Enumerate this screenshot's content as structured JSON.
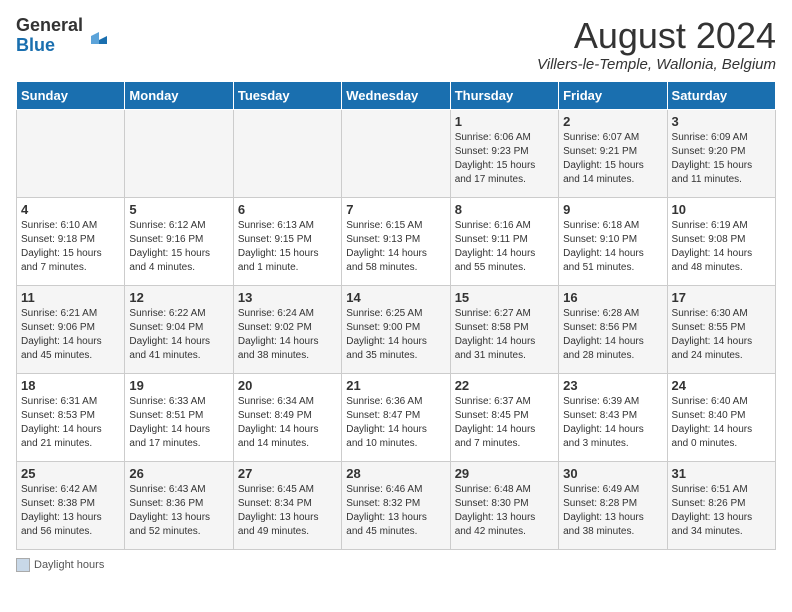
{
  "logo": {
    "general": "General",
    "blue": "Blue"
  },
  "header": {
    "month": "August 2024",
    "location": "Villers-le-Temple, Wallonia, Belgium"
  },
  "weekdays": [
    "Sunday",
    "Monday",
    "Tuesday",
    "Wednesday",
    "Thursday",
    "Friday",
    "Saturday"
  ],
  "legend": {
    "label": "Daylight hours"
  },
  "weeks": [
    [
      {
        "day": "",
        "info": ""
      },
      {
        "day": "",
        "info": ""
      },
      {
        "day": "",
        "info": ""
      },
      {
        "day": "",
        "info": ""
      },
      {
        "day": "1",
        "info": "Sunrise: 6:06 AM\nSunset: 9:23 PM\nDaylight: 15 hours and 17 minutes."
      },
      {
        "day": "2",
        "info": "Sunrise: 6:07 AM\nSunset: 9:21 PM\nDaylight: 15 hours and 14 minutes."
      },
      {
        "day": "3",
        "info": "Sunrise: 6:09 AM\nSunset: 9:20 PM\nDaylight: 15 hours and 11 minutes."
      }
    ],
    [
      {
        "day": "4",
        "info": "Sunrise: 6:10 AM\nSunset: 9:18 PM\nDaylight: 15 hours and 7 minutes."
      },
      {
        "day": "5",
        "info": "Sunrise: 6:12 AM\nSunset: 9:16 PM\nDaylight: 15 hours and 4 minutes."
      },
      {
        "day": "6",
        "info": "Sunrise: 6:13 AM\nSunset: 9:15 PM\nDaylight: 15 hours and 1 minute."
      },
      {
        "day": "7",
        "info": "Sunrise: 6:15 AM\nSunset: 9:13 PM\nDaylight: 14 hours and 58 minutes."
      },
      {
        "day": "8",
        "info": "Sunrise: 6:16 AM\nSunset: 9:11 PM\nDaylight: 14 hours and 55 minutes."
      },
      {
        "day": "9",
        "info": "Sunrise: 6:18 AM\nSunset: 9:10 PM\nDaylight: 14 hours and 51 minutes."
      },
      {
        "day": "10",
        "info": "Sunrise: 6:19 AM\nSunset: 9:08 PM\nDaylight: 14 hours and 48 minutes."
      }
    ],
    [
      {
        "day": "11",
        "info": "Sunrise: 6:21 AM\nSunset: 9:06 PM\nDaylight: 14 hours and 45 minutes."
      },
      {
        "day": "12",
        "info": "Sunrise: 6:22 AM\nSunset: 9:04 PM\nDaylight: 14 hours and 41 minutes."
      },
      {
        "day": "13",
        "info": "Sunrise: 6:24 AM\nSunset: 9:02 PM\nDaylight: 14 hours and 38 minutes."
      },
      {
        "day": "14",
        "info": "Sunrise: 6:25 AM\nSunset: 9:00 PM\nDaylight: 14 hours and 35 minutes."
      },
      {
        "day": "15",
        "info": "Sunrise: 6:27 AM\nSunset: 8:58 PM\nDaylight: 14 hours and 31 minutes."
      },
      {
        "day": "16",
        "info": "Sunrise: 6:28 AM\nSunset: 8:56 PM\nDaylight: 14 hours and 28 minutes."
      },
      {
        "day": "17",
        "info": "Sunrise: 6:30 AM\nSunset: 8:55 PM\nDaylight: 14 hours and 24 minutes."
      }
    ],
    [
      {
        "day": "18",
        "info": "Sunrise: 6:31 AM\nSunset: 8:53 PM\nDaylight: 14 hours and 21 minutes."
      },
      {
        "day": "19",
        "info": "Sunrise: 6:33 AM\nSunset: 8:51 PM\nDaylight: 14 hours and 17 minutes."
      },
      {
        "day": "20",
        "info": "Sunrise: 6:34 AM\nSunset: 8:49 PM\nDaylight: 14 hours and 14 minutes."
      },
      {
        "day": "21",
        "info": "Sunrise: 6:36 AM\nSunset: 8:47 PM\nDaylight: 14 hours and 10 minutes."
      },
      {
        "day": "22",
        "info": "Sunrise: 6:37 AM\nSunset: 8:45 PM\nDaylight: 14 hours and 7 minutes."
      },
      {
        "day": "23",
        "info": "Sunrise: 6:39 AM\nSunset: 8:43 PM\nDaylight: 14 hours and 3 minutes."
      },
      {
        "day": "24",
        "info": "Sunrise: 6:40 AM\nSunset: 8:40 PM\nDaylight: 14 hours and 0 minutes."
      }
    ],
    [
      {
        "day": "25",
        "info": "Sunrise: 6:42 AM\nSunset: 8:38 PM\nDaylight: 13 hours and 56 minutes."
      },
      {
        "day": "26",
        "info": "Sunrise: 6:43 AM\nSunset: 8:36 PM\nDaylight: 13 hours and 52 minutes."
      },
      {
        "day": "27",
        "info": "Sunrise: 6:45 AM\nSunset: 8:34 PM\nDaylight: 13 hours and 49 minutes."
      },
      {
        "day": "28",
        "info": "Sunrise: 6:46 AM\nSunset: 8:32 PM\nDaylight: 13 hours and 45 minutes."
      },
      {
        "day": "29",
        "info": "Sunrise: 6:48 AM\nSunset: 8:30 PM\nDaylight: 13 hours and 42 minutes."
      },
      {
        "day": "30",
        "info": "Sunrise: 6:49 AM\nSunset: 8:28 PM\nDaylight: 13 hours and 38 minutes."
      },
      {
        "day": "31",
        "info": "Sunrise: 6:51 AM\nSunset: 8:26 PM\nDaylight: 13 hours and 34 minutes."
      }
    ]
  ]
}
